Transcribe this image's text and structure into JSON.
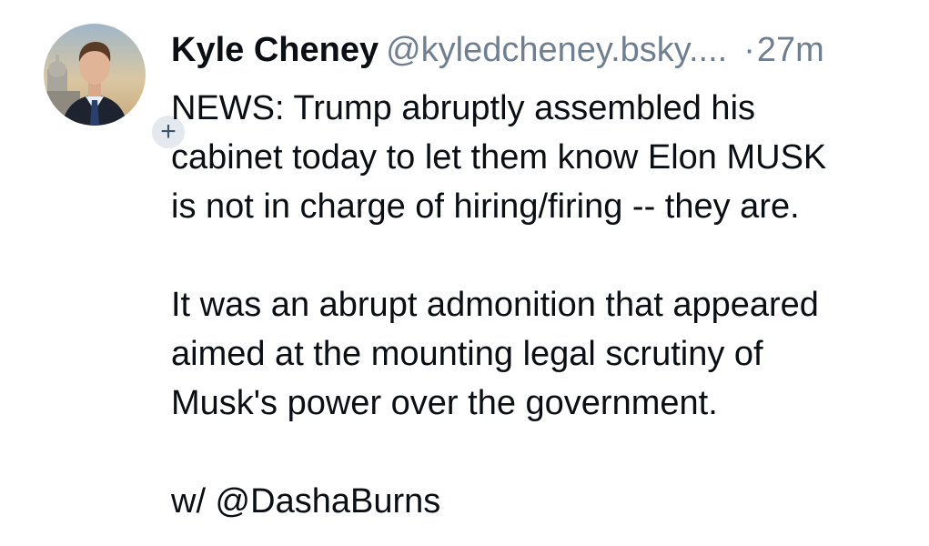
{
  "post": {
    "author": {
      "display_name": "Kyle Cheney",
      "handle": "@kyledcheney.bsky...."
    },
    "separator": "·",
    "timestamp": "27m",
    "follow_badge": "+",
    "paragraphs": [
      "NEWS: Trump abruptly assembled his\ncabinet today to let them know Elon MUSK\nis not in charge of hiring/firing -- they are.",
      "It was an abrupt admonition that appeared\naimed at the mounting legal scrutiny of\nMusk's power over the government.",
      "w/ @DashaBurns"
    ]
  },
  "colors": {
    "text": "#0b0f14",
    "secondary_text": "#6f7f92",
    "badge_bg": "#e4e9ef",
    "badge_fg": "#3d5370"
  }
}
